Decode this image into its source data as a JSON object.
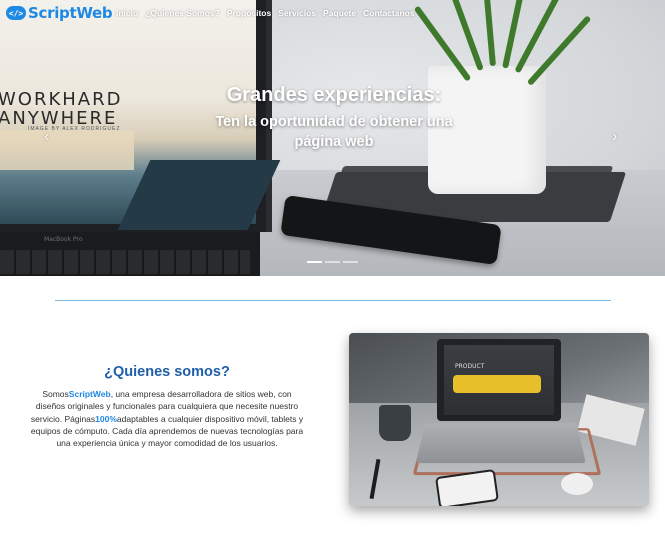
{
  "brand": {
    "badge": "</>",
    "name": "ScriptWeb"
  },
  "nav": {
    "items": [
      {
        "label": "Inicio"
      },
      {
        "label": "¿Quienes Somos?"
      },
      {
        "label": "Propósitos"
      },
      {
        "label": "Servicios"
      },
      {
        "label": "Paquete"
      },
      {
        "label": "Contactanos"
      }
    ]
  },
  "hero": {
    "title": "Grandes experiencias:",
    "subtitle": "Ten la oportunidad de obtener una página web",
    "prev_icon": "chevron-left-icon",
    "next_icon": "chevron-right-icon",
    "slides": 3,
    "active_slide": 1,
    "laptop_text": "WORKHARD\nANYWHERE",
    "laptop_subtext": "IMAGE BY ALEX RODRIGUEZ",
    "laptop_brand": "MacBook Pro"
  },
  "about": {
    "title": "¿Quienes somos?",
    "text_intro": "Somos",
    "text_brand": "ScriptWeb",
    "text_part1": ", una empresa desarrolladora de sitios web, con diseños originales y funcionales para cualquiera que necesite nuestro servicio. Páginas",
    "text_pct": "100%",
    "text_part2": "adaptables a cualquier dispositivo móvil, tablets y equipos de cómputo. Cada día aprendemos de nuevas tecnologías para una experiencia única y mayor comodidad de los usuarios.",
    "photo_label": "PRODUCT"
  },
  "colors": {
    "brand": "#1e88e5",
    "about_title": "#1e5fa8",
    "divider": "#7fb8e0"
  }
}
